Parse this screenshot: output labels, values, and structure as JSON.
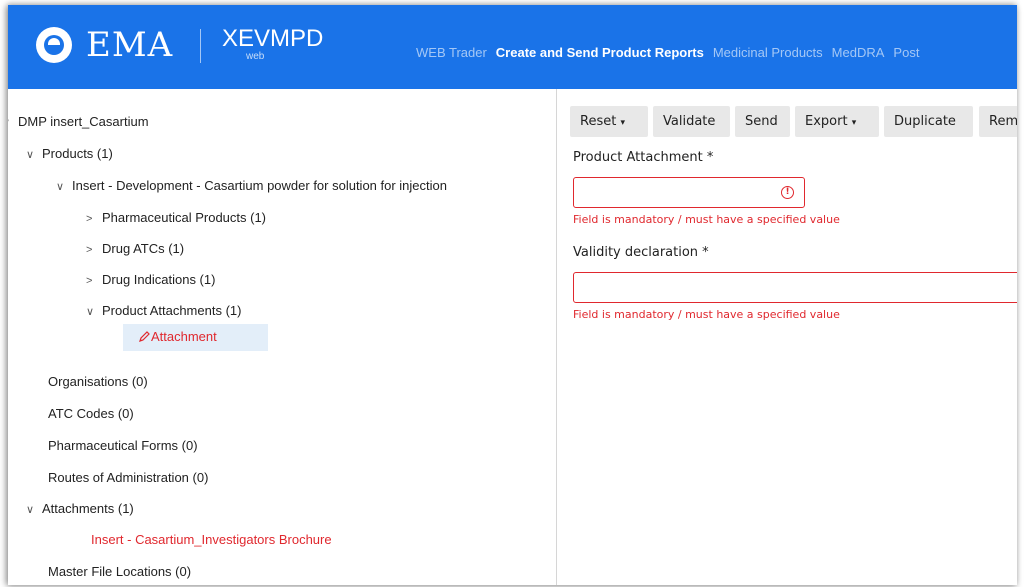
{
  "header": {
    "logo_text": "EMA",
    "app_name": "XEVMPD",
    "app_sub": "web",
    "nav": [
      {
        "label": "WEB Trader",
        "active": false
      },
      {
        "label": "Create and Send Product Reports",
        "active": true
      },
      {
        "label": "Medicinal Products",
        "active": false
      },
      {
        "label": "MedDRA",
        "active": false
      },
      {
        "label": "Post",
        "active": false
      }
    ]
  },
  "tree": {
    "root": "DMP insert_Casartium",
    "products": "Products (1)",
    "product_item": "Insert - Development - Casartium powder for solution for injection",
    "pharma_products": "Pharmaceutical Products (1)",
    "drug_atcs": "Drug ATCs (1)",
    "drug_indications": "Drug Indications (1)",
    "product_attachments": "Product Attachments (1)",
    "attachment": "Attachment",
    "organisations": "Organisations (0)",
    "atc_codes": "ATC Codes (0)",
    "pharma_forms": "Pharmaceutical Forms (0)",
    "routes": "Routes of Administration (0)",
    "attachments": "Attachments (1)",
    "attachment_item": "Insert - Casartium_Investigators Brochure",
    "master_file": "Master File Locations (0)"
  },
  "toolbar": {
    "reset": "Reset",
    "validate": "Validate",
    "send": "Send",
    "export": "Export",
    "duplicate": "Duplicate",
    "remove": "Rem"
  },
  "form": {
    "product_attachment_label": "Product Attachment *",
    "product_attachment_value": "",
    "product_attachment_error": "Field is mandatory / must have a specified value",
    "validity_label": "Validity declaration *",
    "validity_value": "",
    "validity_error": "Field is mandatory / must have a specified value"
  },
  "colors": {
    "header_bg": "#1a73e8",
    "error": "#e0282e",
    "selected_bg": "#e3eef9"
  }
}
